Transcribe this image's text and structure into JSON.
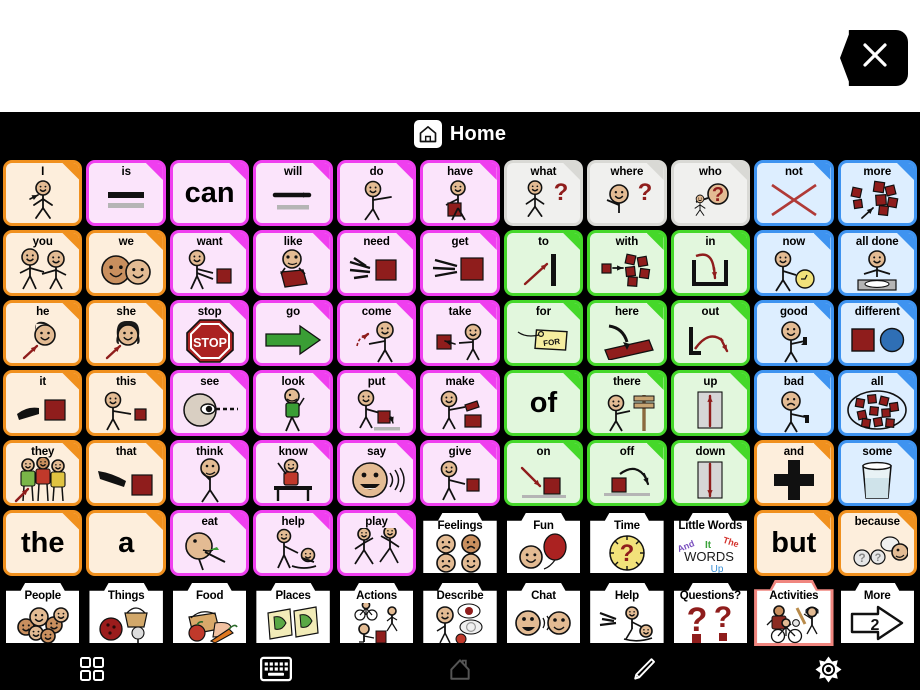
{
  "window": {
    "app_title": "Home",
    "close_label": "close"
  },
  "header": {
    "home_icon": "home-icon",
    "title": "Home"
  },
  "colors": {
    "pronoun_border": "#f0901e",
    "pronoun_bg": "#fdeedc",
    "verb_border": "#ef3fef",
    "verb_bg": "#fbe4fb",
    "question_border": "#d9d9d5",
    "question_bg": "#f0f0ee",
    "descriptor_border": "#3e93f0",
    "descriptor_bg": "#ddeeff",
    "preposition_border": "#45d82a",
    "preposition_bg": "#e2f7dd",
    "category_border": "#000000",
    "selected_border": "#f0867f",
    "background": "#000000",
    "message_bar": "#ffffff"
  },
  "grid": {
    "columns": 11,
    "rows": 7,
    "cells": [
      {
        "label": "I",
        "theme": "orange",
        "art": "person-point-self"
      },
      {
        "label": "is",
        "theme": "pink",
        "art": "equals-bars"
      },
      {
        "label": "can",
        "theme": "pink",
        "art": "text-can",
        "word": "can"
      },
      {
        "label": "will",
        "theme": "pink",
        "art": "arrow-right-bar"
      },
      {
        "label": "do",
        "theme": "pink",
        "art": "person-do"
      },
      {
        "label": "have",
        "theme": "pink",
        "art": "person-hold-block"
      },
      {
        "label": "what",
        "theme": "gray",
        "art": "person-question"
      },
      {
        "label": "where",
        "theme": "gray",
        "art": "person-look-question"
      },
      {
        "label": "who",
        "theme": "gray",
        "art": "person-who-question"
      },
      {
        "label": "not",
        "theme": "blue",
        "art": "red-x"
      },
      {
        "label": "more",
        "theme": "blue",
        "art": "blocks-more"
      },
      {
        "label": "you",
        "theme": "orange",
        "art": "two-people-point"
      },
      {
        "label": "we",
        "theme": "orange",
        "art": "two-faces"
      },
      {
        "label": "want",
        "theme": "pink",
        "art": "person-reach-block"
      },
      {
        "label": "like",
        "theme": "pink",
        "art": "person-hug-book"
      },
      {
        "label": "need",
        "theme": "pink",
        "art": "hands-block"
      },
      {
        "label": "get",
        "theme": "pink",
        "art": "hands-grab-block"
      },
      {
        "label": "to",
        "theme": "green",
        "art": "arrow-to-bar"
      },
      {
        "label": "with",
        "theme": "green",
        "art": "blocks-with"
      },
      {
        "label": "in",
        "theme": "green",
        "art": "arrow-into-box"
      },
      {
        "label": "now",
        "theme": "blue",
        "art": "person-clock"
      },
      {
        "label": "all done",
        "theme": "blue",
        "art": "person-empty-plate"
      },
      {
        "label": "he",
        "theme": "orange",
        "art": "boy-face-arrow"
      },
      {
        "label": "she",
        "theme": "orange",
        "art": "girl-face-arrow"
      },
      {
        "label": "stop",
        "theme": "pink",
        "art": "stop-sign"
      },
      {
        "label": "go",
        "theme": "pink",
        "art": "green-arrow"
      },
      {
        "label": "come",
        "theme": "pink",
        "art": "person-come"
      },
      {
        "label": "take",
        "theme": "pink",
        "art": "person-take-block"
      },
      {
        "label": "for",
        "theme": "green",
        "art": "gift-tag"
      },
      {
        "label": "here",
        "theme": "green",
        "art": "hand-point-here"
      },
      {
        "label": "out",
        "theme": "green",
        "art": "arrow-out-box"
      },
      {
        "label": "good",
        "theme": "blue",
        "art": "thumbs-up-person"
      },
      {
        "label": "different",
        "theme": "blue",
        "art": "square-circle"
      },
      {
        "label": "it",
        "theme": "orange",
        "art": "hand-point-block"
      },
      {
        "label": "this",
        "theme": "orange",
        "art": "person-point-block"
      },
      {
        "label": "see",
        "theme": "pink",
        "art": "eye-look"
      },
      {
        "label": "look",
        "theme": "pink",
        "art": "person-looking"
      },
      {
        "label": "put",
        "theme": "pink",
        "art": "person-put-block"
      },
      {
        "label": "make",
        "theme": "pink",
        "art": "person-make"
      },
      {
        "label": "of",
        "theme": "green",
        "art": "text-of",
        "word": "of"
      },
      {
        "label": "there",
        "theme": "green",
        "art": "person-sign"
      },
      {
        "label": "up",
        "theme": "green",
        "art": "arrow-up-box"
      },
      {
        "label": "bad",
        "theme": "blue",
        "art": "thumbs-down-person"
      },
      {
        "label": "all",
        "theme": "blue",
        "art": "blocks-all"
      },
      {
        "label": "they",
        "theme": "orange",
        "art": "three-people-arrow"
      },
      {
        "label": "that",
        "theme": "orange",
        "art": "hand-point-far-block"
      },
      {
        "label": "think",
        "theme": "pink",
        "art": "person-think"
      },
      {
        "label": "know",
        "theme": "pink",
        "art": "person-desk-hand-up"
      },
      {
        "label": "say",
        "theme": "pink",
        "art": "face-talking"
      },
      {
        "label": "give",
        "theme": "pink",
        "art": "person-give-block"
      },
      {
        "label": "on",
        "theme": "green",
        "art": "arrow-onto-block"
      },
      {
        "label": "off",
        "theme": "green",
        "art": "arrow-off-block"
      },
      {
        "label": "down",
        "theme": "green",
        "art": "arrow-down-box"
      },
      {
        "label": "and",
        "theme": "orange",
        "art": "plus-sign"
      },
      {
        "label": "some",
        "theme": "blue",
        "art": "half-glass"
      },
      {
        "label": "the",
        "theme": "orange",
        "art": "text-the",
        "word": "the"
      },
      {
        "label": "a",
        "theme": "orange",
        "art": "text-a",
        "word": "a"
      },
      {
        "label": "eat",
        "theme": "pink",
        "art": "person-eat"
      },
      {
        "label": "help",
        "theme": "pink",
        "art": "person-help"
      },
      {
        "label": "play",
        "theme": "pink",
        "art": "two-people-running"
      },
      {
        "label": "Feelings",
        "theme": "white",
        "art": "four-faces",
        "folder": true
      },
      {
        "label": "Fun",
        "theme": "white",
        "art": "face-balloon",
        "folder": true
      },
      {
        "label": "Time",
        "theme": "white",
        "art": "clock-question",
        "folder": true
      },
      {
        "label": "Little Words",
        "theme": "white",
        "art": "little-words",
        "folder": true
      },
      {
        "label": "but",
        "theme": "orange",
        "art": "text-but",
        "word": "but"
      },
      {
        "label": "because",
        "theme": "orange",
        "art": "speech-bubbles-because"
      },
      {
        "label": "People",
        "theme": "white",
        "art": "many-faces",
        "folder": true
      },
      {
        "label": "Things",
        "theme": "white",
        "art": "ball-basket-fan",
        "folder": true
      },
      {
        "label": "Food",
        "theme": "white",
        "art": "bread-apple-carrot",
        "folder": true
      },
      {
        "label": "Places",
        "theme": "white",
        "art": "two-maps",
        "folder": true
      },
      {
        "label": "Actions",
        "theme": "white",
        "art": "bike-walk-push",
        "folder": true
      },
      {
        "label": "Describe",
        "theme": "white",
        "art": "person-describe",
        "folder": true
      },
      {
        "label": "Chat",
        "theme": "white",
        "art": "two-faces-talking",
        "folder": true
      },
      {
        "label": "Help",
        "theme": "white",
        "art": "hands-help-person",
        "folder": true
      },
      {
        "label": "Questions?",
        "theme": "white",
        "art": "two-question-marks",
        "folder": true
      },
      {
        "label": "Activities",
        "theme": "white",
        "art": "bike-baseball-people",
        "folder": true,
        "selected": true
      },
      {
        "label": "More",
        "theme": "white",
        "art": "arrow-more-2",
        "folder": true,
        "page": "2"
      }
    ]
  },
  "little_words": {
    "word1": "And",
    "word2": "It",
    "word3": "The",
    "word4": "WORDS",
    "word5": "Up",
    "color1": "#7a4fbf",
    "color2": "#3aa33a",
    "color3": "#d4322c",
    "color4": "#1a1a1a",
    "color5": "#3a8fd4"
  },
  "more_tile": {
    "page_number": "2"
  },
  "toolbar": {
    "buttons": [
      {
        "name": "grid-view-button",
        "icon": "grid-icon",
        "active": true
      },
      {
        "name": "keyboard-button",
        "icon": "keyboard-icon",
        "active": true
      },
      {
        "name": "home-button",
        "icon": "home-icon",
        "active": false
      },
      {
        "name": "edit-button",
        "icon": "pencil-icon",
        "active": true
      },
      {
        "name": "settings-button",
        "icon": "gear-icon",
        "active": true
      }
    ]
  }
}
